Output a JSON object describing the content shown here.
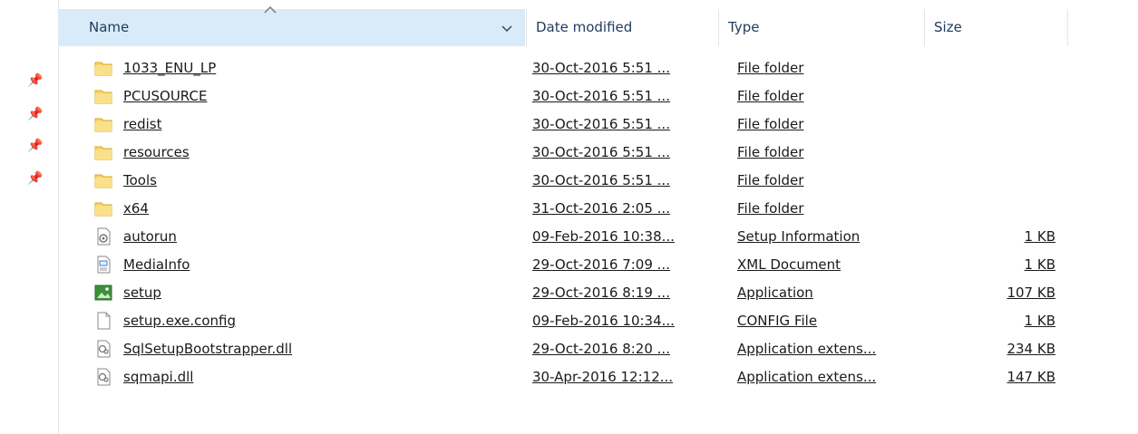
{
  "columns": {
    "name": "Name",
    "date": "Date modified",
    "type": "Type",
    "size": "Size"
  },
  "files": [
    {
      "name": "1033_ENU_LP",
      "date": "30-Oct-2016 5:51 ...",
      "type": "File folder",
      "size": "",
      "icon": "folder-icon"
    },
    {
      "name": "PCUSOURCE",
      "date": "30-Oct-2016 5:51 ...",
      "type": "File folder",
      "size": "",
      "icon": "folder-icon"
    },
    {
      "name": "redist",
      "date": "30-Oct-2016 5:51 ...",
      "type": "File folder",
      "size": "",
      "icon": "folder-icon"
    },
    {
      "name": "resources",
      "date": "30-Oct-2016 5:51 ...",
      "type": "File folder",
      "size": "",
      "icon": "folder-icon"
    },
    {
      "name": "Tools",
      "date": "30-Oct-2016 5:51 ...",
      "type": "File folder",
      "size": "",
      "icon": "folder-icon"
    },
    {
      "name": "x64",
      "date": "31-Oct-2016 2:05 ...",
      "type": "File folder",
      "size": "",
      "icon": "folder-icon"
    },
    {
      "name": "autorun",
      "date": "09-Feb-2016 10:38...",
      "type": "Setup Information",
      "size": "1 KB",
      "icon": "setup-information-icon"
    },
    {
      "name": "MediaInfo",
      "date": "29-Oct-2016 7:09 ...",
      "type": "XML Document",
      "size": "1 KB",
      "icon": "xml-document-icon"
    },
    {
      "name": "setup",
      "date": "29-Oct-2016 8:19 ...",
      "type": "Application",
      "size": "107 KB",
      "icon": "application-icon"
    },
    {
      "name": "setup.exe.config",
      "date": "09-Feb-2016 10:34...",
      "type": "CONFIG File",
      "size": "1 KB",
      "icon": "blank-file-icon"
    },
    {
      "name": "SqlSetupBootstrapper.dll",
      "date": "29-Oct-2016 8:20 ...",
      "type": "Application extens...",
      "size": "234 KB",
      "icon": "dll-file-icon"
    },
    {
      "name": "sqmapi.dll",
      "date": "30-Apr-2016 12:12...",
      "type": "Application extens...",
      "size": "147 KB",
      "icon": "dll-file-icon"
    }
  ],
  "colors": {
    "header_active": "#d9ebf9",
    "header_text": "#1f3b5c",
    "folder": "#f4c542"
  }
}
